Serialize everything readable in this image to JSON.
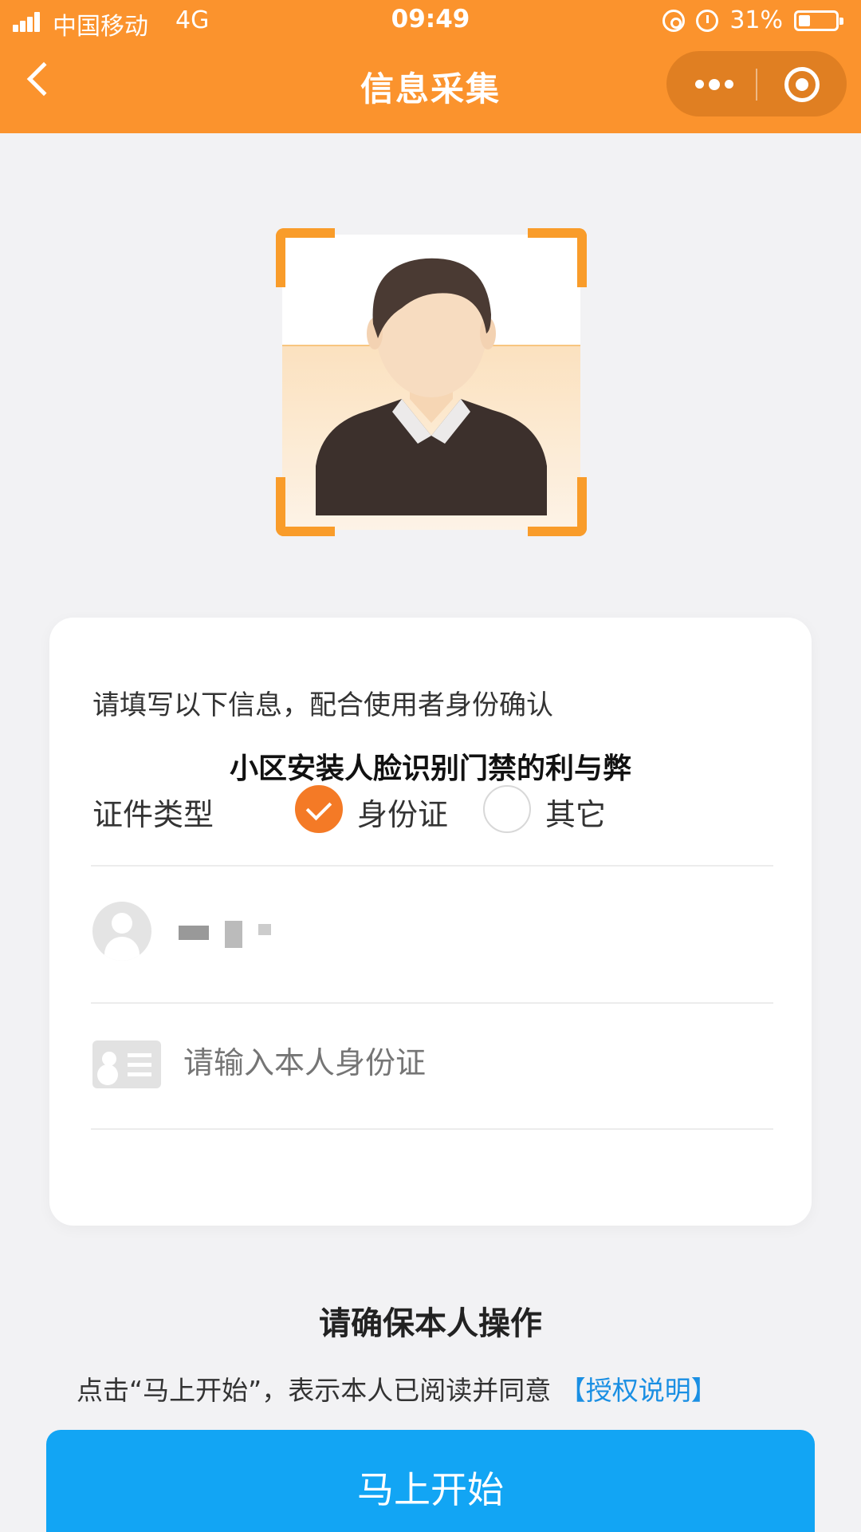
{
  "status_bar": {
    "carrier": "中国移动",
    "network": "4G",
    "time": "09:49",
    "battery": "31%"
  },
  "nav": {
    "title": "信息采集",
    "back_icon": "chevron-left-icon",
    "more_icon": "more-dots-icon",
    "close_icon": "target-circle-icon"
  },
  "face_frame": {
    "icon": "face-portrait-icon",
    "accent_color": "#f99c2a"
  },
  "form": {
    "intro": "请填写以下信息，配合使用者身份确认",
    "id_type_label": "证件类型",
    "options": [
      {
        "label": "身份证",
        "selected": true
      },
      {
        "label": "其它",
        "selected": false
      }
    ],
    "id_placeholder": "请输入本人身份证"
  },
  "overlay_title": "小区安装人脸识别门禁的利与弊",
  "footer": {
    "confirm_title": "请确保本人操作",
    "agree_text": "点击“马上开始”，表示本人已阅读并同意",
    "agree_link": "【授权说明】",
    "start_button": "马上开始"
  },
  "colors": {
    "header": "#fb932d",
    "selected_radio": "#f47a26",
    "link": "#1a8fe3",
    "button": "#12a5f4"
  }
}
